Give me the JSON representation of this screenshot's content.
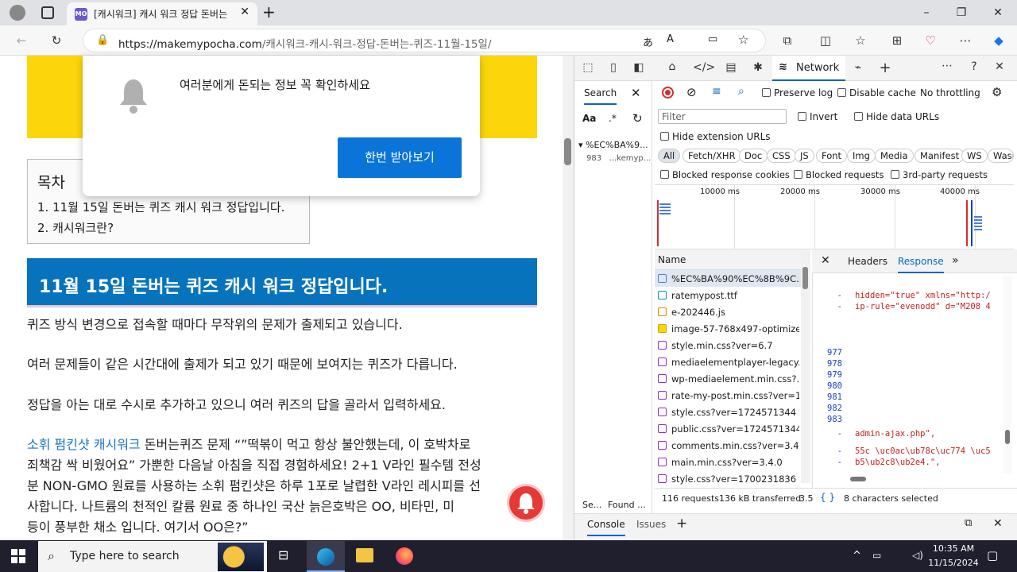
{
  "browser": {
    "tab_title": "[캐시워크] 캐시 워크 정답 돈버는",
    "tab_favicon": "MO",
    "url_host": "https://makemypocha.com",
    "url_path": "/캐시워크-캐시-워크-정답-돈버는-퀴즈-11월-15일/"
  },
  "popup": {
    "message": "여러분에게 돈되는 정보 꼭 확인하세요",
    "button": "한번 받아보기"
  },
  "toc": {
    "heading": "목차",
    "items": [
      "1. 11월 15일 돈버는 퀴즈 캐시 워크 정답입니다.",
      "2. 캐시워크란?"
    ]
  },
  "article": {
    "h2": "11월 15일 돈버는 퀴즈 캐시 워크 정답입니다.",
    "p1": "퀴즈 방식 변경으로 접속할 때마다 무작위의 문제가 출제되고 있습니다.",
    "p2": "여러 문제들이 같은 시간대에 출제가 되고 있기 때문에 보여지는 퀴즈가 다릅니다.",
    "p3": "정답을 아는 대로 수시로 추가하고 있으니 여러 퀴즈의 답을 골라서 입력하세요.",
    "p4_link": "소휘 펌킨샷 캐시워크",
    "p4_line1": " 돈버는퀴즈 문제 “”떡볶이 먹고 항상 불안했는데, 이 호박차로",
    "p4_line2": "죄책감 싹 비웠어요” 가뿐한 다음날 아침을 직접 경험하세요! 2+1 V라인 필수템 전성",
    "p4_line3": "분 NON-GMO 원료를 사용하는 소휘 펌킨샷은 하루 1포로 날렵한 V라인 레시피를 선",
    "p4_line4": "사합니다. 나트륨의 천적인 칼륨 원료 중 하나인 국산 늙은호박은 OO, 비타민, 미",
    "p4_line5": "등이 풍부한 채소 입니다. 여기서 OO은?”"
  },
  "devtools": {
    "network_tab": "Network",
    "search_tab": "Search",
    "search_result_header": "%EC%BA%9...",
    "search_result_line": "983",
    "search_result_text": "...kemyp...",
    "preserve_log": "Preserve log",
    "disable_cache": "Disable cache",
    "throttling": "No throttling",
    "filter_placeholder": "Filter",
    "invert": "Invert",
    "hide_data_urls": "Hide data URLs",
    "hide_extension_urls": "Hide extension URLs",
    "chips": [
      "All",
      "Fetch/XHR",
      "Doc",
      "CSS",
      "JS",
      "Font",
      "Img",
      "Media",
      "Manifest",
      "WS",
      "Wasm"
    ],
    "blocked_cookies": "Blocked response cookies",
    "blocked_requests": "Blocked requests",
    "third_party": "3rd-party requests",
    "timeline_labels": [
      "10000 ms",
      "20000 ms",
      "30000 ms",
      "40000 ms"
    ],
    "name_header": "Name",
    "requests": [
      "%EC%BA%90%EC%8B%9C...",
      "ratemypost.ttf",
      "e-202446.js",
      "image-57-768x497-optimize...",
      "style.min.css?ver=6.7",
      "mediaelementplayer-legacy...",
      "wp-mediaelement.min.css?...",
      "rate-my-post.min.css?ver=1...",
      "style.css?ver=1724571344",
      "public.css?ver=1724571344",
      "comments.min.css?ver=3.4.0",
      "main.min.css?ver=3.4.0",
      "style.css?ver=1700231836"
    ],
    "panel_tabs": [
      "Headers",
      "Response"
    ],
    "code_lines": [
      {
        "n": "",
        "t": "hidden=\"true\" xmlns=\"http:/"
      },
      {
        "n": "",
        "t": "ip-rule=\"evenodd\" d=\"M208 4"
      },
      {
        "n": "977",
        "t": ""
      },
      {
        "n": "978",
        "t": ""
      },
      {
        "n": "979",
        "t": ""
      },
      {
        "n": "980",
        "t": ""
      },
      {
        "n": "981",
        "t": ""
      },
      {
        "n": "982",
        "t": ""
      },
      {
        "n": "983",
        "t": ""
      },
      {
        "n": "",
        "t": "admin-ajax.php\","
      },
      {
        "n": "",
        "t": "55c \\uc0ac\\ub78c\\uc774 \\uc5"
      },
      {
        "n": "",
        "t": "b5\\ub2c8\\ub2e4.\","
      }
    ],
    "requests_count": "116 requests",
    "transferred": "136 kB transferred",
    "size_cut": "3.5",
    "selected_chars": "8 characters selected",
    "search_footer": "Se...",
    "found_footer": "Found ...",
    "drawer_tabs": [
      "Console",
      "Issues"
    ]
  },
  "taskbar": {
    "search_placeholder": "Type here to search",
    "time": "10:35 AM",
    "date": "11/15/2024"
  },
  "colors": {
    "accent": "#0a66c2",
    "heading_bg": "#0873bd",
    "banner": "#fcd60a",
    "popup_btn": "#0a74d9"
  }
}
